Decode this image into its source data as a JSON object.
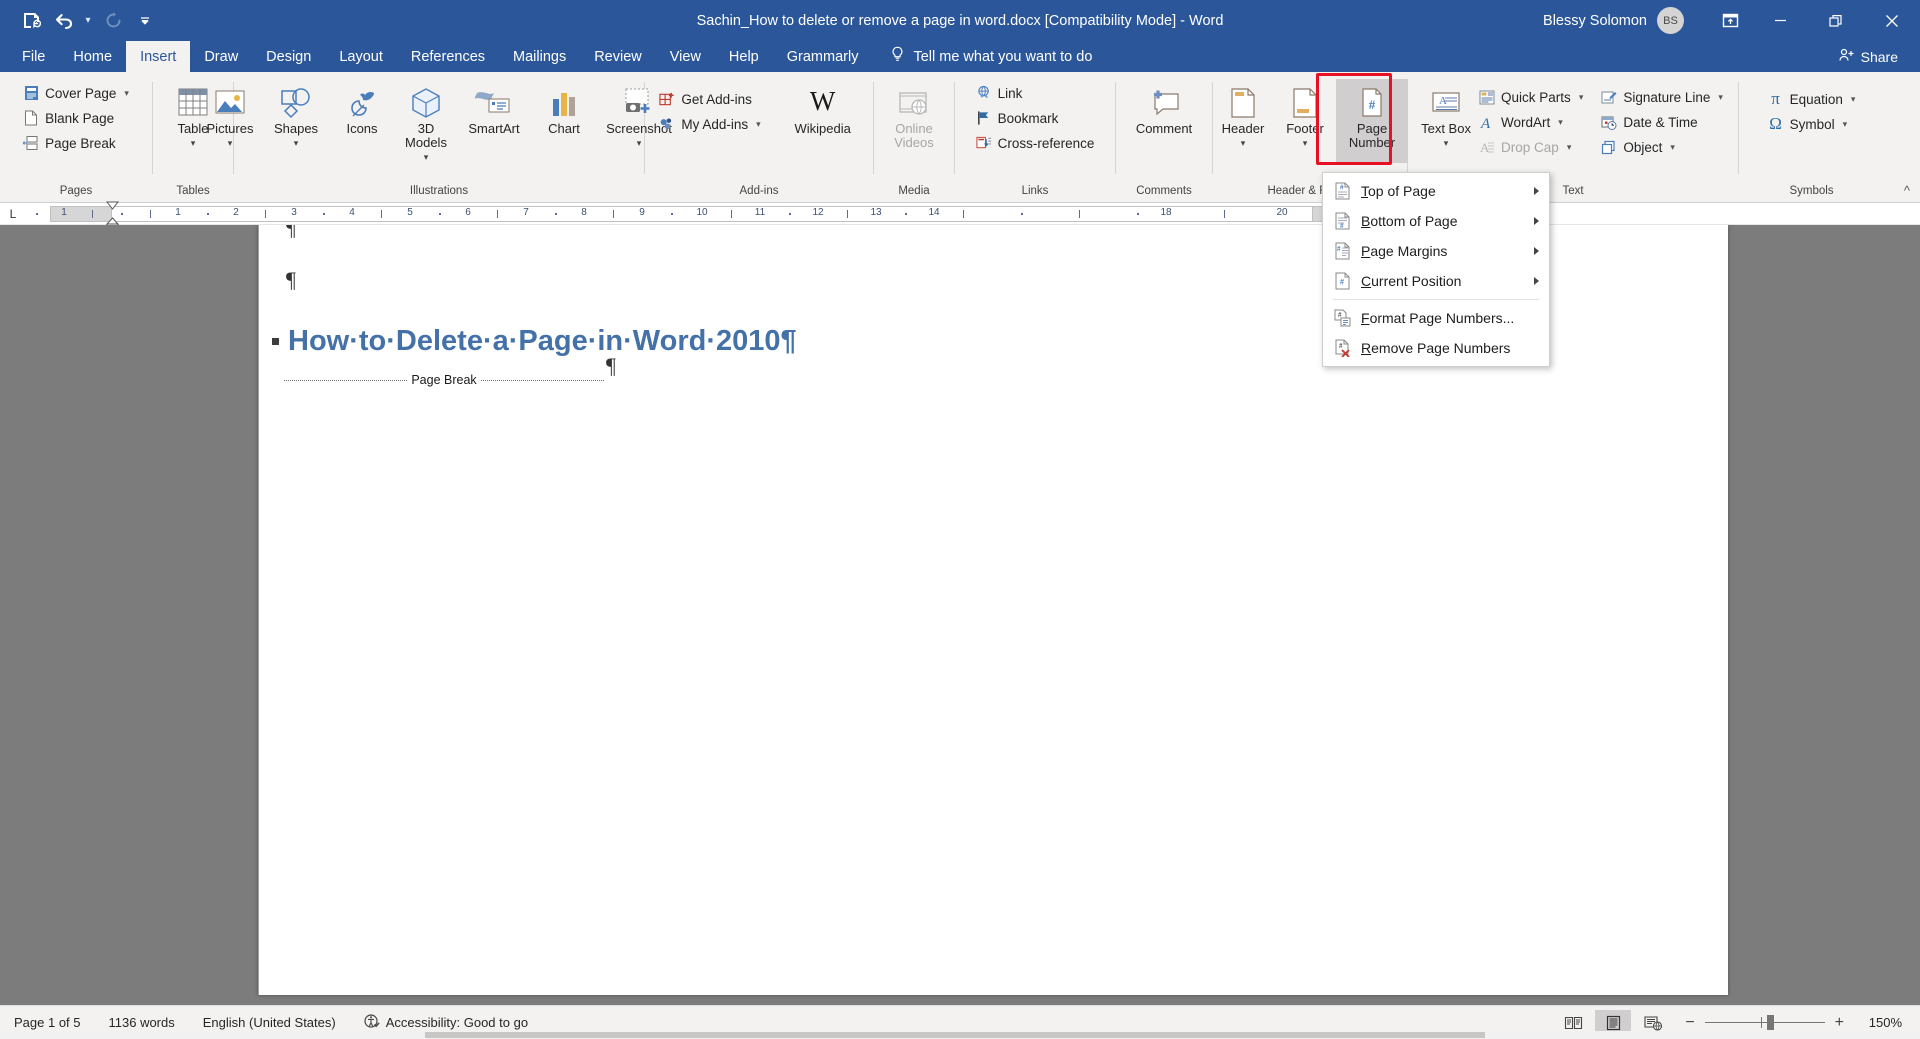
{
  "titlebar": {
    "document_title": "Sachin_How to delete or remove a page in word.docx [Compatibility Mode]  -  Word",
    "user_name": "Blessy Solomon",
    "avatar_initials": "BS",
    "quick_access": [
      {
        "name": "save-icon",
        "label": "Save"
      },
      {
        "name": "undo-icon",
        "label": "Undo"
      },
      {
        "name": "redo-icon",
        "label": "Redo"
      },
      {
        "name": "customize-qat-icon",
        "label": "Customize Quick Access Toolbar"
      }
    ],
    "window_controls": {
      "ribbon_display_options": "Ribbon Display Options",
      "minimize": "Minimize",
      "restore": "Restore Down",
      "close": "Close"
    }
  },
  "tabs": [
    {
      "label": "File",
      "active": false
    },
    {
      "label": "Home",
      "active": false
    },
    {
      "label": "Insert",
      "active": true
    },
    {
      "label": "Draw",
      "active": false
    },
    {
      "label": "Design",
      "active": false
    },
    {
      "label": "Layout",
      "active": false
    },
    {
      "label": "References",
      "active": false
    },
    {
      "label": "Mailings",
      "active": false
    },
    {
      "label": "Review",
      "active": false
    },
    {
      "label": "View",
      "active": false
    },
    {
      "label": "Help",
      "active": false
    },
    {
      "label": "Grammarly",
      "active": false
    }
  ],
  "tell_me": "Tell me what you want to do",
  "share": "Share",
  "ribbon": {
    "groups": [
      {
        "label": "Pages",
        "items": [
          {
            "label": "Cover Page",
            "icon": "cover-page-icon",
            "caret": true,
            "disabled": false
          },
          {
            "label": "Blank Page",
            "icon": "blank-page-icon",
            "caret": false,
            "disabled": false
          },
          {
            "label": "Page Break",
            "icon": "page-break-icon",
            "caret": false,
            "disabled": false
          }
        ]
      },
      {
        "label": "Tables",
        "items": [
          {
            "label": "Table",
            "icon": "table-icon",
            "caret": true,
            "disabled": false
          }
        ]
      },
      {
        "label": "Illustrations",
        "items": [
          {
            "label": "Pictures",
            "icon": "pictures-icon",
            "caret": true,
            "disabled": false
          },
          {
            "label": "Shapes",
            "icon": "shapes-icon",
            "caret": true,
            "disabled": false
          },
          {
            "label": "Icons",
            "icon": "icons-icon",
            "caret": false,
            "disabled": false
          },
          {
            "label": "3D Models",
            "icon": "3d-models-icon",
            "caret": true,
            "disabled": false
          },
          {
            "label": "SmartArt",
            "icon": "smartart-icon",
            "caret": false,
            "disabled": false
          },
          {
            "label": "Chart",
            "icon": "chart-icon",
            "caret": false,
            "disabled": false
          },
          {
            "label": "Screenshot",
            "icon": "screenshot-icon",
            "caret": true,
            "disabled": false
          }
        ]
      },
      {
        "label": "Add-ins",
        "items": [
          {
            "label": "Get Add-ins",
            "icon": "get-addins-icon",
            "caret": false,
            "disabled": false
          },
          {
            "label": "My Add-ins",
            "icon": "my-addins-icon",
            "caret": true,
            "disabled": false
          },
          {
            "label": "Wikipedia",
            "icon": "wikipedia-icon",
            "caret": false,
            "disabled": false
          }
        ]
      },
      {
        "label": "Media",
        "items": [
          {
            "label": "Online Videos",
            "icon": "online-videos-icon",
            "caret": false,
            "disabled": true
          }
        ]
      },
      {
        "label": "Links",
        "items": [
          {
            "label": "Link",
            "icon": "link-icon",
            "caret": false,
            "disabled": false
          },
          {
            "label": "Bookmark",
            "icon": "bookmark-icon",
            "caret": false,
            "disabled": false
          },
          {
            "label": "Cross-reference",
            "icon": "cross-reference-icon",
            "caret": false,
            "disabled": false
          }
        ]
      },
      {
        "label": "Comments",
        "items": [
          {
            "label": "Comment",
            "icon": "comment-icon",
            "caret": false,
            "disabled": false
          }
        ]
      },
      {
        "label": "Header & Footer",
        "items": [
          {
            "label": "Header",
            "icon": "header-icon",
            "caret": true,
            "disabled": false
          },
          {
            "label": "Footer",
            "icon": "footer-icon",
            "caret": true,
            "disabled": false
          },
          {
            "label": "Page Number",
            "icon": "page-number-icon",
            "caret": true,
            "disabled": false,
            "selected": true,
            "highlighted": true
          }
        ]
      },
      {
        "label": "Text",
        "items": [
          {
            "label": "Text Box",
            "icon": "text-box-icon",
            "caret": true,
            "disabled": false
          },
          {
            "label": "Quick Parts",
            "icon": "quick-parts-icon",
            "caret": true,
            "disabled": false
          },
          {
            "label": "WordArt",
            "icon": "wordart-icon",
            "caret": true,
            "disabled": false
          },
          {
            "label": "Drop Cap",
            "icon": "drop-cap-icon",
            "caret": true,
            "disabled": true
          },
          {
            "label": "Signature Line",
            "icon": "signature-line-icon",
            "caret": true,
            "disabled": false
          },
          {
            "label": "Date & Time",
            "icon": "date-time-icon",
            "caret": false,
            "disabled": false
          },
          {
            "label": "Object",
            "icon": "object-icon",
            "caret": true,
            "disabled": false
          }
        ]
      },
      {
        "label": "Symbols",
        "items": [
          {
            "label": "Equation",
            "icon": "equation-icon",
            "caret": true,
            "disabled": false
          },
          {
            "label": "Symbol",
            "icon": "symbol-icon",
            "caret": true,
            "disabled": false
          }
        ]
      }
    ],
    "collapse_label": "Collapse the Ribbon"
  },
  "page_number_menu": {
    "items": [
      {
        "label": "Top of Page",
        "mnemonic": "T",
        "icon": "page-number-top-icon",
        "submenu": true
      },
      {
        "label": "Bottom of Page",
        "mnemonic": "B",
        "icon": "page-number-bottom-icon",
        "submenu": true
      },
      {
        "label": "Page Margins",
        "mnemonic": "P",
        "icon": "page-number-margins-icon",
        "submenu": true
      },
      {
        "label": "Current Position",
        "mnemonic": "C",
        "icon": "page-number-current-icon",
        "submenu": true
      },
      {
        "separator": true
      },
      {
        "label": "Format Page Numbers...",
        "mnemonic": "F",
        "icon": "format-page-numbers-icon",
        "submenu": false
      },
      {
        "label": "Remove Page Numbers",
        "mnemonic": "R",
        "icon": "remove-page-numbers-icon",
        "submenu": false
      }
    ]
  },
  "ruler": {
    "numbers": [
      "1",
      "1",
      "2",
      "3",
      "4",
      "5",
      "6",
      "7",
      "8",
      "9",
      "10",
      "11",
      "12",
      "13",
      "14",
      "18",
      "20"
    ],
    "tab_selector": "L"
  },
  "document": {
    "heading": "How·to·Delete·a·Page·in·Word·2010¶",
    "page_break_label": "Page Break",
    "paragraph_marks": [
      "¶",
      "¶",
      "¶"
    ]
  },
  "statusbar": {
    "page_info": "Page 1 of 5",
    "word_count": "1136 words",
    "language": "English (United States)",
    "accessibility": "Accessibility: Good to go",
    "views": [
      {
        "name": "read-mode-view",
        "label": "Read Mode",
        "active": false
      },
      {
        "name": "print-layout-view",
        "label": "Print Layout",
        "active": true
      },
      {
        "name": "web-layout-view",
        "label": "Web Layout",
        "active": false
      }
    ],
    "zoom_out": "Zoom Out",
    "zoom_in": "Zoom In",
    "zoom_level": "150%"
  },
  "colors": {
    "word_blue": "#2b579a",
    "ribbon_bg": "#f3f2f1",
    "highlight_red": "#e81123",
    "heading_blue": "#4472a8"
  }
}
